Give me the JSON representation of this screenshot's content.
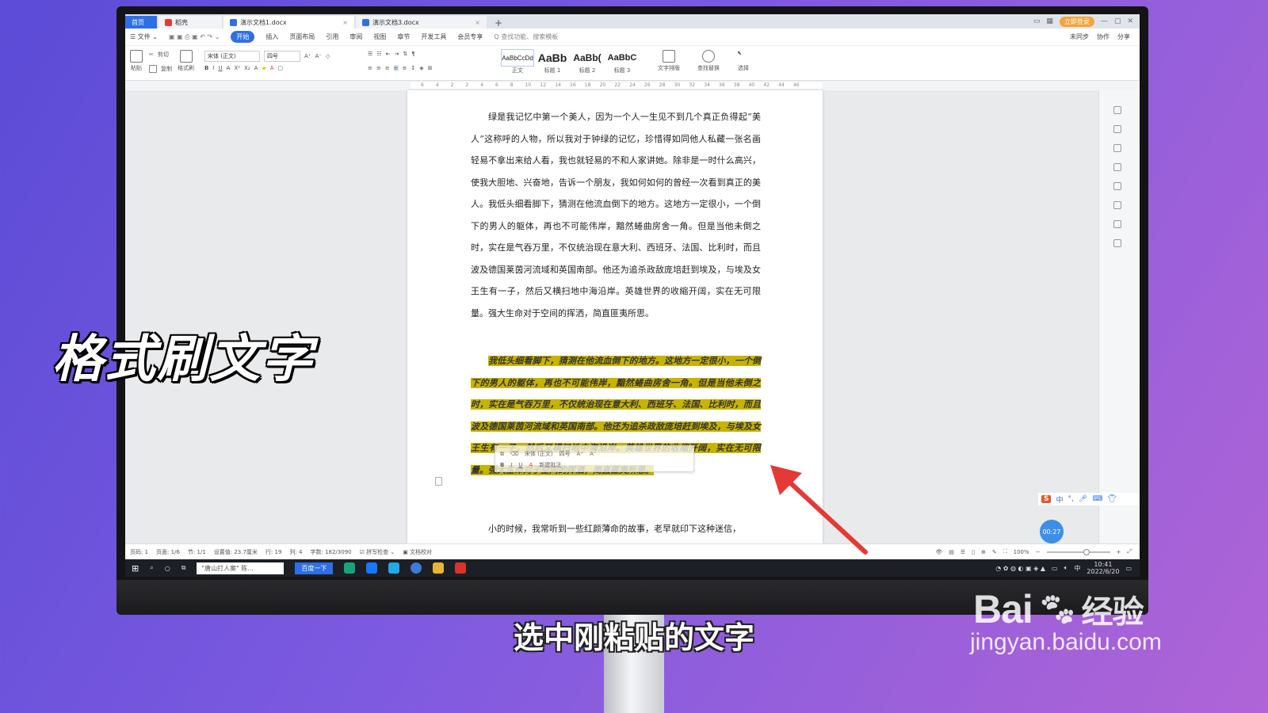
{
  "window": {
    "tabs": [
      {
        "label": "首页"
      },
      {
        "label": "稻壳"
      },
      {
        "label": "演示文档1.docx"
      },
      {
        "label": "演示文档3.docx"
      }
    ],
    "new_tab": "+",
    "vip_badge": "立即登录"
  },
  "menu": {
    "file": "☰ 文件 ⌄",
    "items": [
      "开始",
      "插入",
      "页面布局",
      "引用",
      "审阅",
      "视图",
      "章节",
      "开发工具",
      "会员专享"
    ],
    "search": "Q 查找功能、搜索模板",
    "right": [
      "未同步",
      "协作",
      "分享"
    ]
  },
  "ribbon": {
    "paste": "粘贴",
    "cut": "剪切",
    "copy": "复制",
    "format_painter": "格式刷",
    "font_name": "宋体 (正文)",
    "font_size": "四号",
    "styles": [
      {
        "sample": "AaBbCcDd",
        "label": "正文"
      },
      {
        "sample": "AaBb",
        "label": "标题 1"
      },
      {
        "sample": "AaBb(",
        "label": "标题 2"
      },
      {
        "sample": "AaBbC",
        "label": "标题 3"
      }
    ],
    "text_layout": "文字排版",
    "find_replace": "查找替换",
    "select": "选择"
  },
  "ruler": {
    "ticks": [
      "6",
      "4",
      "2",
      "2",
      "4",
      "6",
      "8",
      "10",
      "12",
      "14",
      "16",
      "18",
      "20",
      "22",
      "24",
      "26",
      "28",
      "30",
      "32",
      "34",
      "36",
      "38",
      "40",
      "42",
      "44",
      "46"
    ]
  },
  "document": {
    "paragraph1": "绿是我记忆中第一个美人，因为一个人一生见不到几个真正负得起“美人”这称呼的人物，所以我对于钟绿的记忆，珍惜得如同他人私藏一张名画轻易不拿出来给人看，我也就轻易的不和人家讲她。除非是一时什么高兴，使我大胆地、兴奋地，告诉一个朋友，我如何如何的曾经一次看到真正的美人。我低头细看脚下，猜测在他流血倒下的地方。这地方一定很小，一个倒下的男人的躯体，再也不可能伟岸，黯然蜷曲房舍一角。但是当他未倒之时，实在是气吞万里，不仅统治现在意大利、西班牙、法国、比利时，而且波及德国莱茵河流域和英国南部。他还为追杀政敌庞培赶到埃及，与埃及女王生有一子，然后又横扫地中海沿岸。英雄世界的收縮开阔，实在无可限量。强大生命对于空间的挥洒，简直匪夷所思。",
    "paragraph2": "我低头细看脚下，猜测在他流血倒下的地方。这地方一定很小，一个倒下的男人的躯体，再也不可能伟岸，黯然蜷曲房舍一角。但是当他未倒之时，实在是气吞万里，不仅统治现在意大利、西班牙、法国、比利时，而且波及德国莱茵河流域和英国南部。他还为追杀政敌庞培赶到埃及，与埃及女王生有一子，然后又横扫地中海沿岸。英雄世界的收缩开阔，实在无可限量。强大生命对于空间的挥洒，简直匪夷所思。",
    "paragraph3": "小的时候，我常听到一些红颜薄命的故事，老早就印下这种迷信，",
    "highlight_color": "#c8b400"
  },
  "minibar": {
    "font": "宋体 (正文)",
    "size": "四号",
    "bold": "B",
    "italic": "I",
    "underline": "U",
    "font_color": "A",
    "new_comment": "新建批注"
  },
  "ime": {
    "logo": "S",
    "mode": "中"
  },
  "timer": "00:27",
  "status": {
    "page_num": "页码: 1",
    "pages": "页面: 1/6",
    "section": "节: 1/1",
    "position": "设置值: 23.7厘米",
    "line": "行: 19",
    "column": "列: 4",
    "word_count": "字数: 182/3090",
    "spell_check": "拼写检查",
    "proofread": "文档校对",
    "zoom": "100%",
    "zoom_minus": "−",
    "zoom_plus": "+"
  },
  "taskbar": {
    "search_text": "\"唐山打人案\" 陈...",
    "baidu_button": "百度一下",
    "ime_label": "中",
    "time": "10:41",
    "date": "2022/6/20"
  },
  "overlay": {
    "title": "格式刷文字",
    "subtitle": "选中刚粘贴的文字",
    "watermark_brand": "Bai",
    "watermark_brand2": "经验",
    "watermark_url": "jingyan.baidu.com"
  },
  "colors": {
    "accent": "#2f6fe6",
    "arrow": "#e53935",
    "highlight": "#c8b400"
  }
}
